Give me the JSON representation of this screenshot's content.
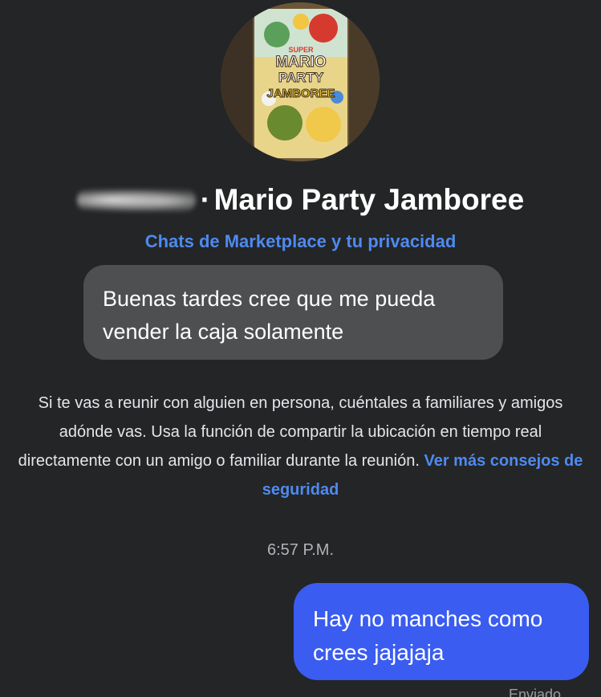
{
  "header": {
    "title": "Mario Party Jamboree",
    "separator": "·",
    "privacy_link": "Chats de Marketplace y tu privacidad",
    "avatar_box_text": {
      "line1": "SUPER",
      "line2": "MARIO",
      "line3": "PARTY",
      "line4": "JAMBOREE"
    }
  },
  "messages": {
    "incoming_text": "Buenas tardes cree que me pueda vender la caja solamente",
    "outgoing_text": "Hay no manches como crees jajajaja"
  },
  "safety": {
    "text": "Si te vas a reunir con alguien en persona, cuéntales a familiares y amigos adónde vas. Usa la función de compartir la ubicación en tiempo real directamente con un amigo o familiar durante la reunión.",
    "link": "Ver más consejos de seguridad"
  },
  "timestamp": "6:57 P.M.",
  "status": "Enviado",
  "colors": {
    "background": "#242526",
    "incoming_bubble": "#4e4f50",
    "outgoing_bubble": "#3a5cf0",
    "link": "#4e8af0"
  }
}
